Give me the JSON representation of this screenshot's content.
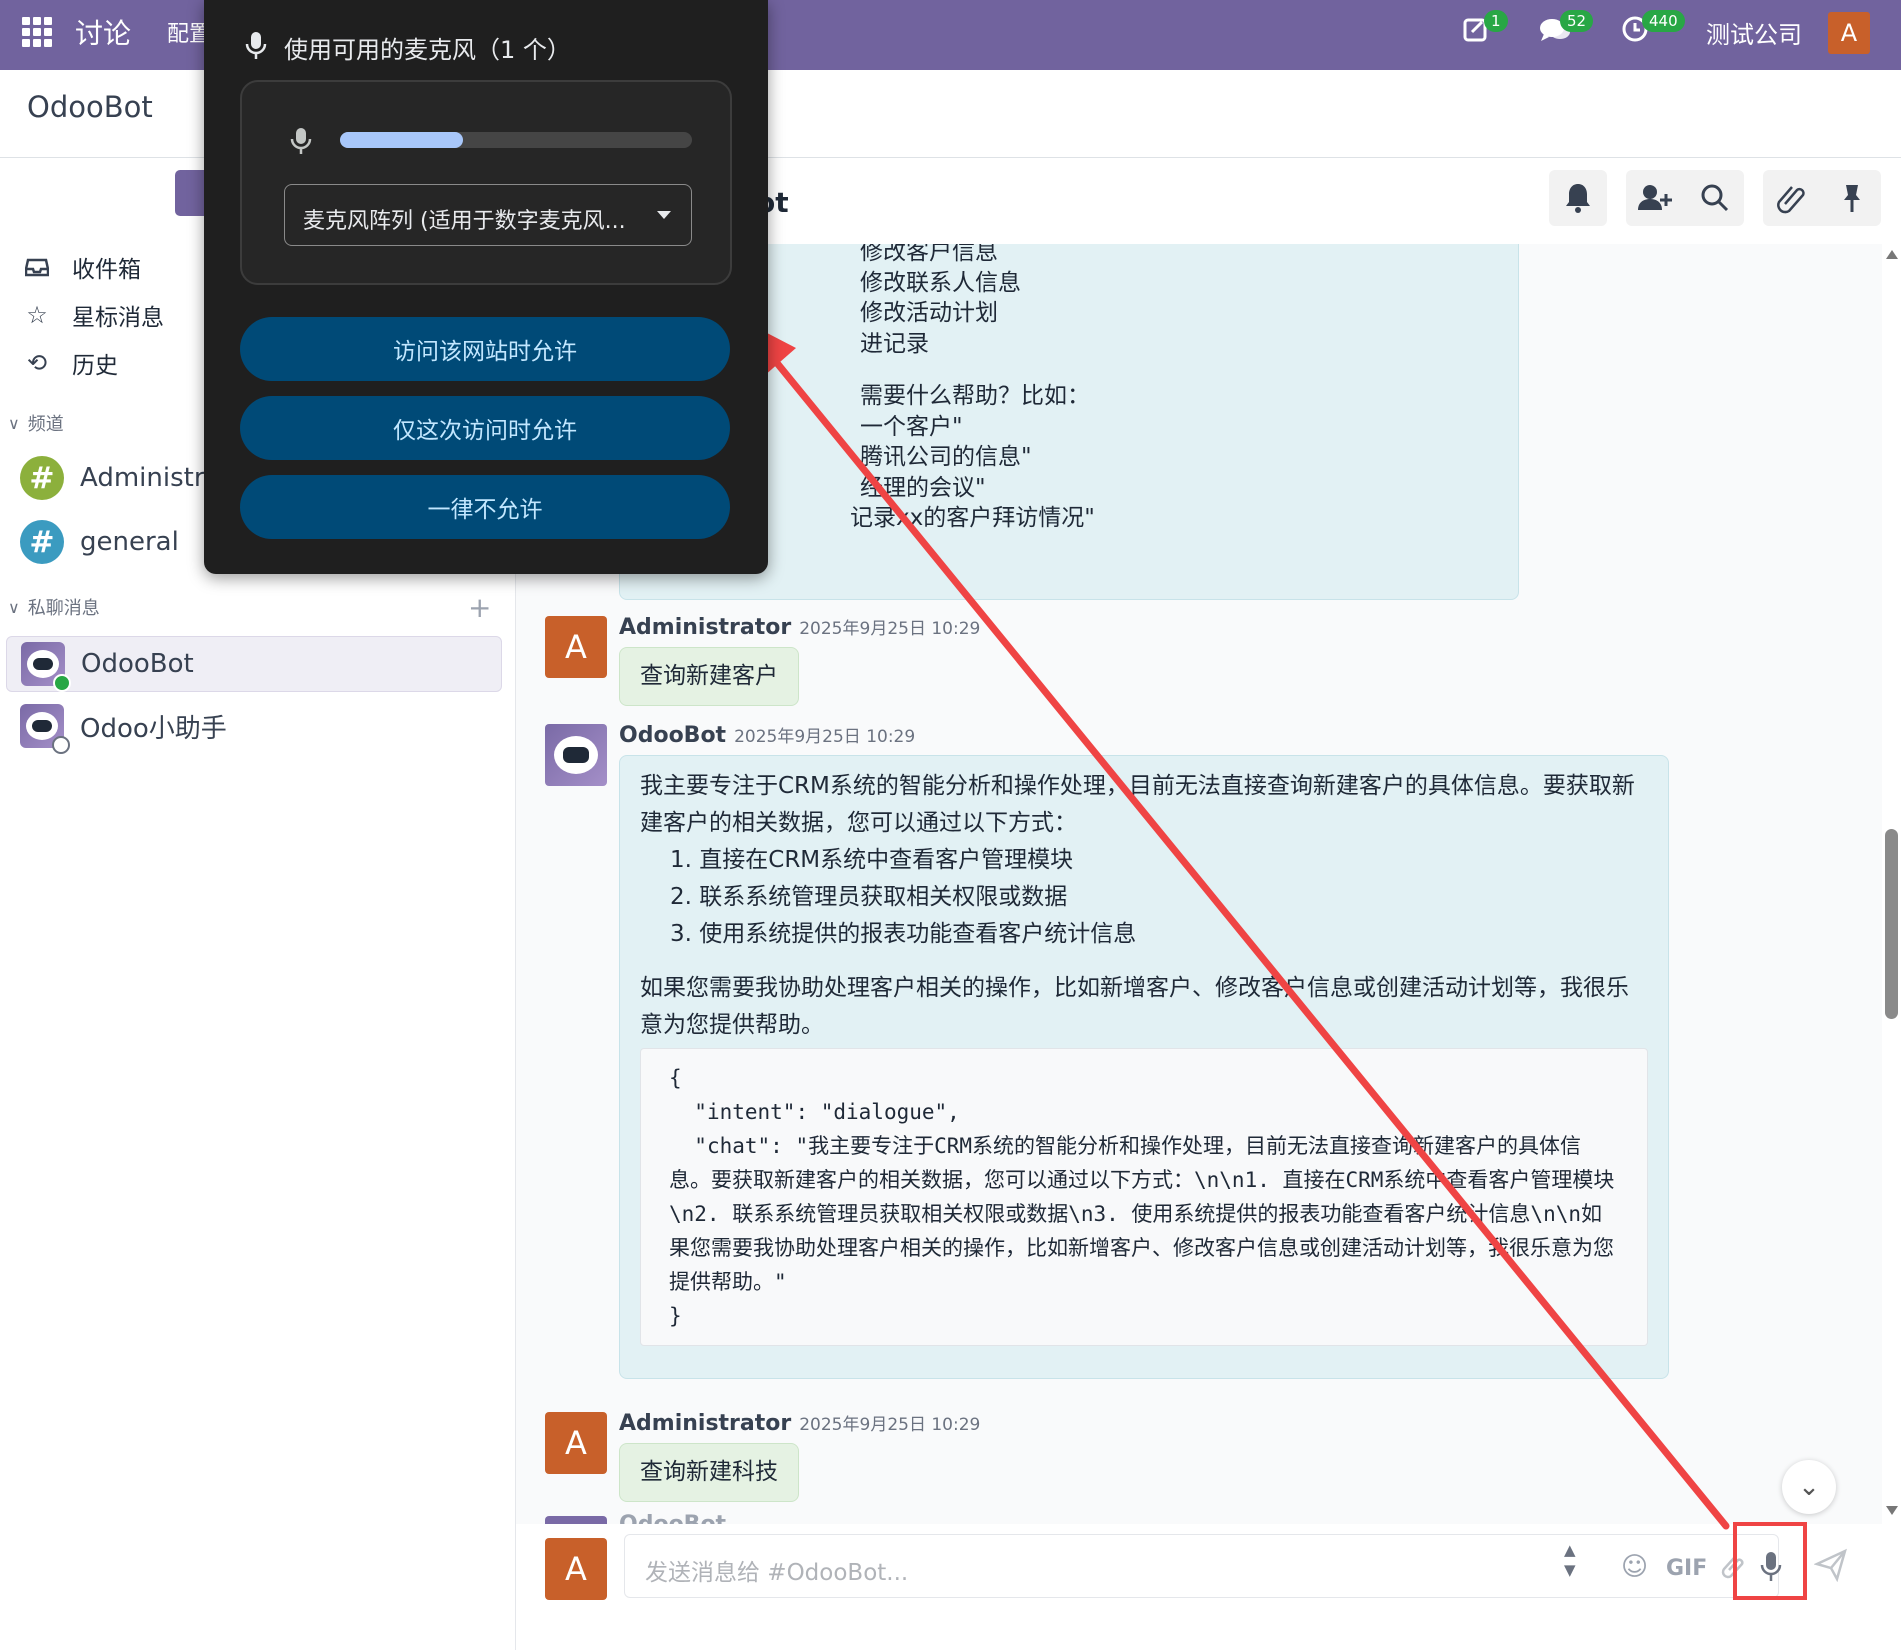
{
  "topbar": {
    "app_title": "讨论",
    "menu_config": "配置",
    "activity_count": "1",
    "messages_count": "52",
    "timer_count": "440",
    "company": "测试公司",
    "user_initial": "A"
  },
  "subheader": {
    "title": "OdooBot"
  },
  "sidebar": {
    "items": [
      {
        "label": "收件箱",
        "icon": "inbox-icon"
      },
      {
        "label": "星标消息",
        "icon": "star-icon"
      },
      {
        "label": "历史",
        "icon": "history-icon"
      }
    ],
    "channels_header": "频道",
    "channels": [
      {
        "label": "Administrat",
        "color": "#8cb03c"
      },
      {
        "label": "general",
        "color": "#3b9bc0"
      }
    ],
    "dm_header": "私聊消息",
    "dms": [
      {
        "label": "OdooBot",
        "status": "online"
      },
      {
        "label": "Odoo小助手",
        "status": "offline"
      }
    ]
  },
  "chat": {
    "header_title": "ot",
    "earlier_bot_lines": [
      "修改客户信息",
      "修改联系人信息",
      "修改活动计划",
      "进记录",
      "",
      "需要什么帮助？比如：",
      "一个客户\"",
      "腾讯公司的信息\"",
      "经理的会议\"",
      "记录xx的客户拜访情况\""
    ],
    "messages": [
      {
        "author": "Administrator",
        "date": "2025年9月25日 10:29",
        "text": "查询新建客户"
      },
      {
        "author": "OdooBot",
        "date": "2025年9月25日 10:29",
        "p1": "我主要专注于CRM系统的智能分析和操作处理，目前无法直接查询新建客户的具体信息。要获取新建客户的相关数据，您可以通过以下方式：",
        "list": [
          "1. 直接在CRM系统中查看客户管理模块",
          "2. 联系系统管理员获取相关权限或数据",
          "3. 使用系统提供的报表功能查看客户统计信息"
        ],
        "p2": "如果您需要我协助处理客户相关的操作，比如新增客户、修改客户信息或创建活动计划等，我很乐意为您提供帮助。",
        "code": "{\n  \"intent\": \"dialogue\",\n  \"chat\": \"我主要专注于CRM系统的智能分析和操作处理，目前无法直接查询新建客户的具体信息。要获取新建客户的相关数据，您可以通过以下方式：\\n\\n1. 直接在CRM系统中查看客户管理模块\\n2. 联系系统管理员获取相关权限或数据\\n3. 使用系统提供的报表功能查看客户统计信息\\n\\n如果您需要我协助处理客户相关的操作，比如新增客户、修改客户信息或创建活动计划等，我很乐意为您提供帮助。\"\n}"
      },
      {
        "author": "Administrator",
        "date": "2025年9月25日 10:29",
        "text": "查询新建科技"
      }
    ],
    "partial_author": "OdooBot"
  },
  "composer": {
    "placeholder": "发送消息给 #OdooBot...",
    "gif_label": "GIF",
    "user_initial": "A"
  },
  "permission_popup": {
    "title": "使用可用的麦克风（1 个）",
    "level": 0.35,
    "device": "麦克风阵列 (适用于数字麦克风...",
    "allow_site": "访问该网站时允许",
    "allow_once": "仅这次访问时允许",
    "never_allow": "一律不允许"
  },
  "colors": {
    "brand": "#71639e",
    "annotation": "#ef4444",
    "popup_button": "#004a77"
  }
}
